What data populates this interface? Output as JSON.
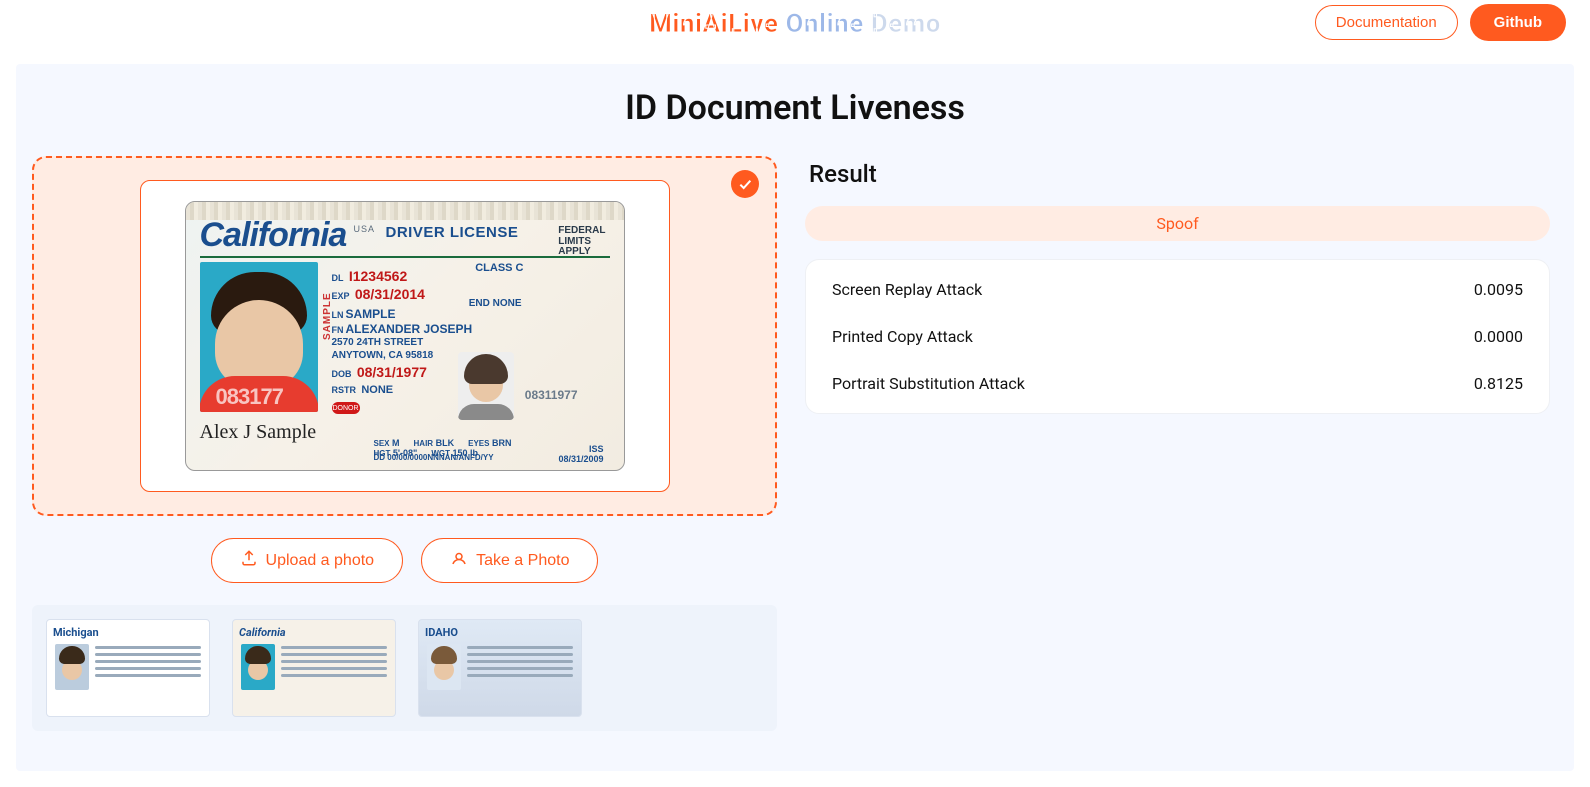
{
  "header": {
    "brand_w1": "MiniAiLive",
    "brand_w2": "Online",
    "brand_w3": "Demo",
    "doc_btn": "Documentation",
    "github_btn": "Github"
  },
  "page": {
    "title": "ID Document Liveness",
    "upload_btn": "Upload a photo",
    "take_btn": "Take a Photo"
  },
  "license": {
    "state": "California",
    "usa": "USA",
    "title": "DRIVER LICENSE",
    "federal": "FEDERAL\nLIMITS\nAPPLY",
    "class_lbl": "CLASS C",
    "dl_lbl": "DL",
    "dl_val": "I1234562",
    "exp_lbl": "EXP",
    "exp_val": "08/31/2014",
    "end_lbl": "END",
    "end_val": "NONE",
    "ln_lbl": "LN",
    "ln_val": "SAMPLE",
    "fn_lbl": "FN",
    "fn_val": "ALEXANDER JOSEPH",
    "addr1": "2570 24TH STREET",
    "addr2": "ANYTOWN, CA 95818",
    "dob_lbl": "DOB",
    "dob_val": "08/31/1977",
    "rstr_lbl": "RSTR",
    "rstr_val": "NONE",
    "donor": "DONOR",
    "sample_vert": "SAMPLE",
    "ghost_num": "08311977",
    "big_ghost_num": "083177",
    "sex_lbl": "SEX",
    "sex_val": "M",
    "hair_lbl": "HAIR",
    "hair_val": "BLK",
    "eyes_lbl": "EYES",
    "eyes_val": "BRN",
    "hgt_lbl": "HGT",
    "hgt_val": "5'-08\"",
    "wgt_lbl": "WGT",
    "wgt_val": "150 lb",
    "iss_lbl": "ISS",
    "iss_val": "08/31/2009",
    "dd_lbl": "DD",
    "dd_val": "00/00/0000NNNAN/ANFD/YY",
    "signature": "Alex J Sample"
  },
  "thumbs": [
    {
      "state": "Michigan"
    },
    {
      "state": "California"
    },
    {
      "state": "IDAHO"
    }
  ],
  "result": {
    "title": "Result",
    "verdict": "Spoof",
    "scores": [
      {
        "label": "Screen Replay Attack",
        "value": "0.0095"
      },
      {
        "label": "Printed Copy Attack",
        "value": "0.0000"
      },
      {
        "label": "Portrait Substitution Attack",
        "value": "0.8125"
      }
    ]
  }
}
